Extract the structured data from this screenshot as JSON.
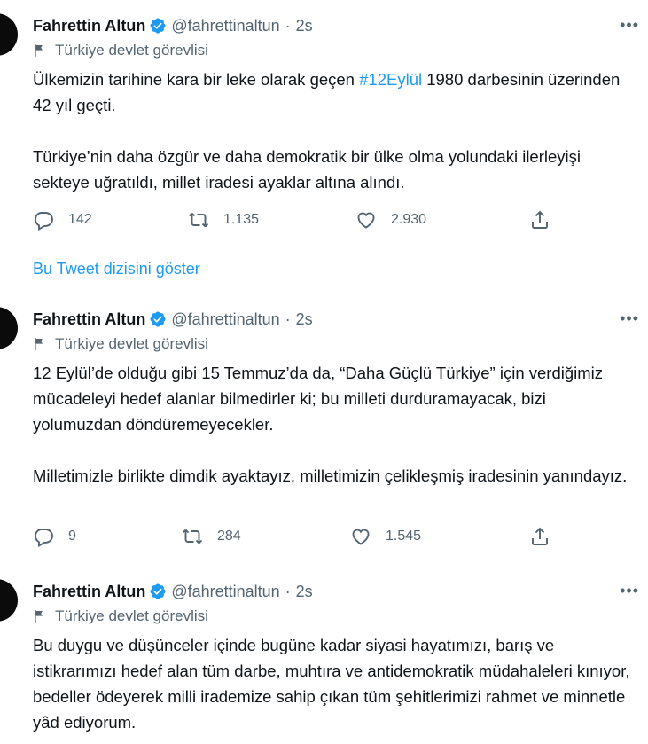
{
  "tweets": [
    {
      "name": "Fahrettin Altun",
      "handle": "@fahrettinaltun",
      "sep": "·",
      "time": "2s",
      "more": "•••",
      "label": "Türkiye devlet görevlisi",
      "text_pre": "Ülkemizin tarihine kara bir leke olarak geçen ",
      "hashtag": "#12Eylül",
      "text_post": " 1980 darbesinin üzerinden 42 yıl geçti.",
      "text_p2": "Türkiye’nin daha özgür ve daha demokratik bir ülke olma yolundaki ilerleyişi sekteye uğratıldı, millet iradesi ayaklar altına alındı.",
      "replies": "142",
      "retweets": "1.135",
      "likes": "2.930"
    },
    {
      "name": "Fahrettin Altun",
      "handle": "@fahrettinaltun",
      "sep": "·",
      "time": "2s",
      "more": "•••",
      "label": "Türkiye devlet görevlisi",
      "text_p1": "12 Eylül’de olduğu gibi 15 Temmuz’da da, “Daha Güçlü Türkiye” için verdiğimiz mücadeleyi hedef alanlar bilmedirler ki; bu milleti durduramayacak, bizi yolumuzdan döndüremeyecekler.",
      "text_p2": "Milletimizle birlikte dimdik ayaktayız, milletimizin çelikleşmiş iradesinin yanındayız.",
      "replies": "9",
      "retweets": "284",
      "likes": "1.545"
    },
    {
      "name": "Fahrettin Altun",
      "handle": "@fahrettinaltun",
      "sep": "·",
      "time": "2s",
      "more": "•••",
      "label": "Türkiye devlet görevlisi",
      "text_p1": "Bu duygu ve düşünceler içinde bugüne kadar siyasi hayatımızı, barış ve istikrarımızı hedef alan tüm darbe, muhtıra ve antidemokratik müdahaleleri kınıyor, bedeller ödeyerek milli irademize sahip çıkan tüm şehitlerimizi rahmet ve minnetle yâd ediyorum."
    }
  ],
  "thread_link": "Bu Tweet dizisini göster",
  "colors": {
    "accent": "#1d9bf0",
    "muted": "#536471",
    "text": "#0f1419"
  },
  "icons": [
    "verified-badge-icon",
    "flag-icon",
    "reply-icon",
    "retweet-icon",
    "like-icon",
    "share-icon",
    "more-icon"
  ]
}
